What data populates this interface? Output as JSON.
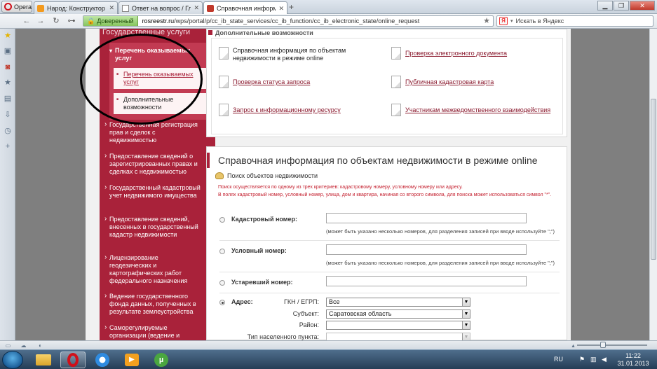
{
  "browser": {
    "menu_label": "Opera",
    "tabs": [
      {
        "label": "Народ: Конструктор с..."
      },
      {
        "label": "Ответ на вопрос / Гла..."
      },
      {
        "label": "Справочная информа..."
      }
    ],
    "new_tab": "+",
    "secure_label": "Доверенный",
    "url_host": "rosreestr.ru",
    "url_path": "/wps/portal/p/cc_ib_state_services/cc_ib_function/cc_ib_electronic_state/online_request",
    "search_placeholder": "Искать в Яндекс",
    "search_badge": "Я"
  },
  "left_nav": {
    "header": "Государственные услуги",
    "open_item": "Перечень оказываемых услуг",
    "sub_items": [
      {
        "label": "Перечень оказываемых услуг",
        "active": true
      },
      {
        "label": "Дополнительные возможности",
        "active": false
      }
    ],
    "items": [
      "Государственная регистрация прав и сделок с недвижимостью",
      "Предоставление сведений о зарегистрированных правах и сделках с недвижимостью",
      "Государственный кадастровый учет недвижимого имущества",
      "Предоставление сведений, внесенных в государственный кадастр недвижимости",
      "Лицензирование геодезических и картографических работ федерального назначения",
      "Ведение государственного фонда данных, полученных в результате землеустройства",
      "Саморегулируемые организации (ведение и"
    ]
  },
  "extra_features": {
    "header": "Дополнительные возможности",
    "links": [
      {
        "label": "Справочная информация по объектам недвижимости в режиме online",
        "underline": false
      },
      {
        "label": "Проверка электронного документа",
        "underline": true
      },
      {
        "label": "Проверка статуса запроса",
        "underline": true
      },
      {
        "label": "Публичная кадастровая карта",
        "underline": true
      },
      {
        "label": "Запрос к информационному ресурсу",
        "underline": true
      },
      {
        "label": "Участникам межведомственного взаимодействия",
        "underline": true
      }
    ]
  },
  "search_form": {
    "title": "Справочная информация по объектам недвижимости в режиме online",
    "box_title": "Поиск объектов недвижимости",
    "note_line1": "Поиск осуществляется по одному из трех критериев: кадастровому номеру, условному номеру или адресу.",
    "note_line2": "В полях кадастровый номер, условный номер, улица, дом и квартира, начиная со второго символа, для поиска может использоваться символ \"*\".",
    "fields": [
      {
        "label": "Кадастровый номер:",
        "value": "",
        "hint": "(может быть указано несколько номеров, для разделения записей при вводе используйте \";\")"
      },
      {
        "label": "Условный номер:",
        "value": "",
        "hint": "(может быть указано несколько номеров, для разделения записей при вводе используйте \";\")"
      },
      {
        "label": "Устаревший номер:",
        "value": "",
        "hint": ""
      }
    ],
    "address": {
      "label": "Адрес:",
      "selected": true,
      "rows": [
        {
          "label": "ГКН / ЕГРП:",
          "value": "Все"
        },
        {
          "label": "Субъект:",
          "value": "Саратовская область"
        },
        {
          "label": "Район:",
          "value": ""
        },
        {
          "label": "Тип населенного пункта:",
          "value": ""
        }
      ]
    }
  },
  "taskbar": {
    "lang": "RU",
    "time": "11:22",
    "date": "31.01.2013"
  },
  "colors": {
    "brand_red": "#a9223a",
    "note_red": "#c4202f"
  }
}
